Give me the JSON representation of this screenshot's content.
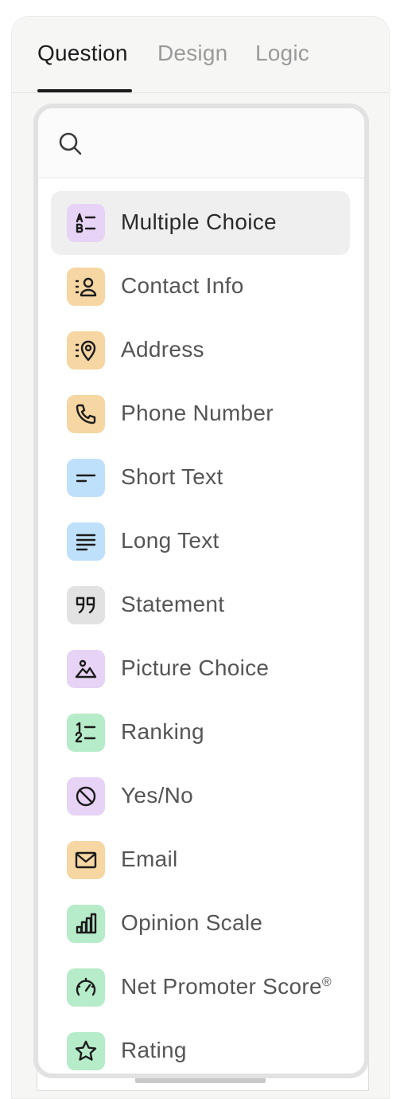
{
  "tabs": {
    "question": "Question",
    "design": "Design",
    "logic": "Logic"
  },
  "search": {
    "placeholder": "",
    "value": ""
  },
  "colors": {
    "purple": "#e7d3f5",
    "orange": "#f6d6a2",
    "blue": "#bfe0fb",
    "gray": "#e2e2e2",
    "green": "#b6ecc9"
  },
  "items": [
    {
      "label": "Multiple Choice",
      "icon": "multiple-choice-icon",
      "color": "purple"
    },
    {
      "label": "Contact Info",
      "icon": "contact-info-icon",
      "color": "orange"
    },
    {
      "label": "Address",
      "icon": "address-icon",
      "color": "orange"
    },
    {
      "label": "Phone Number",
      "icon": "phone-icon",
      "color": "orange"
    },
    {
      "label": "Short Text",
      "icon": "short-text-icon",
      "color": "blue"
    },
    {
      "label": "Long Text",
      "icon": "long-text-icon",
      "color": "blue"
    },
    {
      "label": "Statement",
      "icon": "quote-icon",
      "color": "gray"
    },
    {
      "label": "Picture Choice",
      "icon": "picture-icon",
      "color": "purple"
    },
    {
      "label": "Ranking",
      "icon": "ranking-icon",
      "color": "green"
    },
    {
      "label": "Yes/No",
      "icon": "yes-no-icon",
      "color": "purple"
    },
    {
      "label": "Email",
      "icon": "email-icon",
      "color": "orange"
    },
    {
      "label": "Opinion Scale",
      "icon": "opinion-scale-icon",
      "color": "green"
    },
    {
      "label": "Net Promoter Score",
      "label_mark": "®",
      "icon": "gauge-icon",
      "color": "green"
    },
    {
      "label": "Rating",
      "icon": "star-icon",
      "color": "green"
    }
  ]
}
